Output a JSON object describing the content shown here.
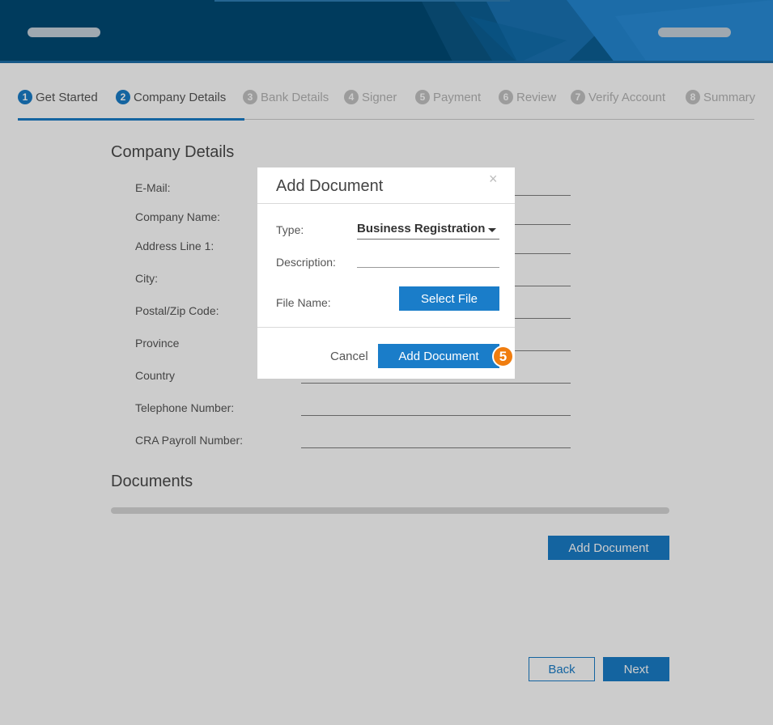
{
  "steps": [
    {
      "num": "1",
      "label": "Get Started"
    },
    {
      "num": "2",
      "label": "Company Details"
    },
    {
      "num": "3",
      "label": "Bank Details"
    },
    {
      "num": "4",
      "label": "Signer"
    },
    {
      "num": "5",
      "label": "Payment"
    },
    {
      "num": "6",
      "label": "Review"
    },
    {
      "num": "7",
      "label": "Verify Account"
    },
    {
      "num": "8",
      "label": "Summary"
    }
  ],
  "company": {
    "title": "Company Details",
    "fields": [
      {
        "label": "E-Mail:"
      },
      {
        "label": "Company Name:"
      },
      {
        "label": "Address Line 1:"
      },
      {
        "label": "City:"
      },
      {
        "label": "Postal/Zip Code:"
      },
      {
        "label": "Province"
      },
      {
        "label": "Country"
      },
      {
        "label": "Telephone Number:"
      },
      {
        "label": "CRA Payroll Number:"
      }
    ]
  },
  "documents": {
    "title": "Documents",
    "add_button": "Add Document"
  },
  "nav": {
    "back": "Back",
    "next": "Next"
  },
  "modal": {
    "title": "Add Document",
    "close_icon": "×",
    "type_label": "Type:",
    "type_value": "Business Registration",
    "description_label": "Description:",
    "description_value": "",
    "file_label": "File Name:",
    "select_file": "Select File",
    "cancel": "Cancel",
    "submit": "Add Document"
  },
  "annotation": {
    "badge": "5"
  },
  "colors": {
    "primary": "#1a7dc9",
    "header": "#004a75",
    "badge": "#f07d0f"
  }
}
